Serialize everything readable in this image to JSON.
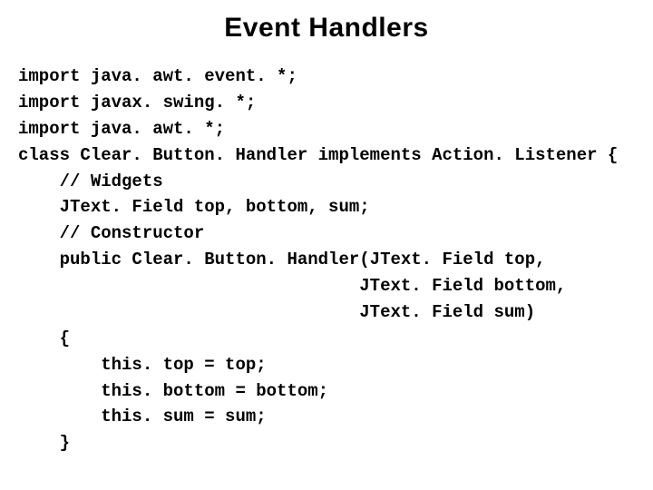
{
  "title": "Event Handlers",
  "code": {
    "l1": "import java. awt. event. *;",
    "l2": "import javax. swing. *;",
    "l3": "import java. awt. *;",
    "l4": "class Clear. Button. Handler implements Action. Listener {",
    "l5": "    // Widgets",
    "l6": "    JText. Field top, bottom, sum;",
    "l7": "    // Constructor",
    "l8": "    public Clear. Button. Handler(JText. Field top,",
    "l9": "                                 JText. Field bottom,",
    "l10": "                                 JText. Field sum)",
    "l11": "    {",
    "l12": "        this. top = top;",
    "l13": "        this. bottom = bottom;",
    "l14": "        this. sum = sum;",
    "l15": "    }"
  }
}
